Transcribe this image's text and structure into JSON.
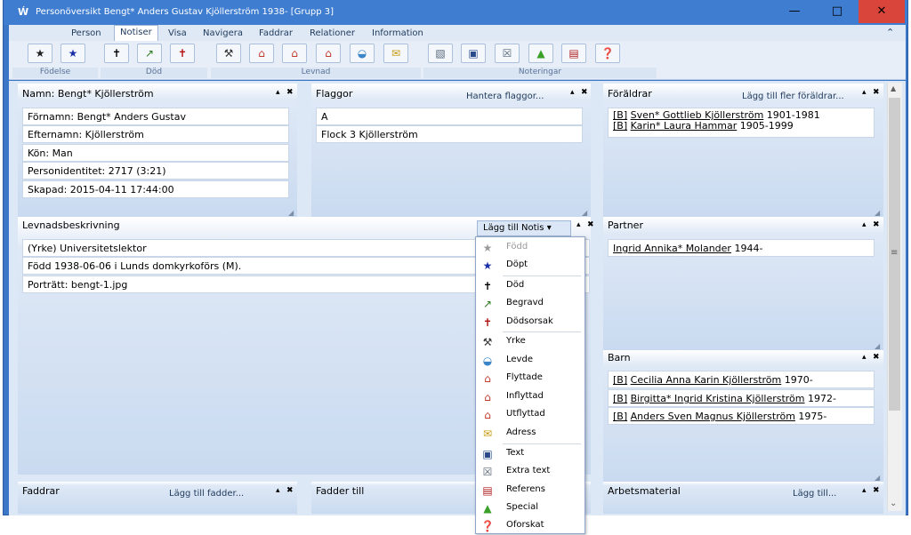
{
  "window": {
    "title": "Personöversikt Bengt* Anders Gustav Kjöllerström 1938- [Grupp 3]",
    "app_icon": "Ẃ",
    "min_glyph": "—",
    "max_glyph": "□",
    "close_glyph": "✕"
  },
  "tabs": [
    {
      "label": "Person"
    },
    {
      "label": "Notiser"
    },
    {
      "label": "Visa"
    },
    {
      "label": "Navigera"
    },
    {
      "label": "Faddrar"
    },
    {
      "label": "Relationer"
    },
    {
      "label": "Information"
    }
  ],
  "ribbon_collapse": "⌃",
  "ribbon_groups": [
    "Födelse",
    "Död",
    "Levnad",
    "Noteringar"
  ],
  "ribbon_icons": [
    {
      "icon": "gray-star-icon",
      "glyph": "★",
      "color": "#222222"
    },
    {
      "icon": "blue-star-icon",
      "glyph": "★",
      "color": "#1a2fa8"
    },
    {
      "icon": "cross-icon",
      "glyph": "✝",
      "color": "#000000"
    },
    {
      "icon": "shovel-icon",
      "glyph": "↗",
      "color": "#2a7a1a"
    },
    {
      "icon": "cross-red-icon",
      "glyph": "✝",
      "color": "#b01010"
    },
    {
      "icon": "hammer-icon",
      "glyph": "⚒",
      "color": "#333333"
    },
    {
      "icon": "house-out-icon",
      "glyph": "⌂",
      "color": "#c0392b"
    },
    {
      "icon": "house-in-icon",
      "glyph": "⌂",
      "color": "#c0392b"
    },
    {
      "icon": "house-move-icon",
      "glyph": "⌂",
      "color": "#c0392b"
    },
    {
      "icon": "globe-house-icon",
      "glyph": "◒",
      "color": "#3a86c8"
    },
    {
      "icon": "envelope-icon",
      "glyph": "✉",
      "color": "#c89a10"
    },
    {
      "icon": "picture-icon",
      "glyph": "▧",
      "color": "#556677"
    },
    {
      "icon": "text-icon",
      "glyph": "▣",
      "color": "#2a4a8a"
    },
    {
      "icon": "extra-text-icon",
      "glyph": "☒",
      "color": "#556677"
    },
    {
      "icon": "warning-icon",
      "glyph": "▲",
      "color": "#3aa02a"
    },
    {
      "icon": "reference-icon",
      "glyph": "▤",
      "color": "#b02020"
    },
    {
      "icon": "unresearched-icon",
      "glyph": "❓",
      "color": "#8a2aa8"
    }
  ],
  "namn_panel": {
    "title": "Namn: Bengt* Kjöllerström",
    "fields": [
      "Förnamn: Bengt* Anders Gustav",
      "Efternamn: Kjöllerström",
      "Kön: Man",
      "Personidentitet: 2717 (3:21)",
      "Skapad: 2015-04-11 17:44:00"
    ]
  },
  "flaggor_panel": {
    "title": "Flaggor",
    "action": "Hantera flaggor...",
    "fields": [
      "A",
      "Flock 3 Kjöllerström"
    ]
  },
  "foraldrar_panel": {
    "title": "Föräldrar",
    "action": "Lägg till fler föräldrar...",
    "items": [
      {
        "tag": "[B]",
        "name": "Sven* Gottlieb Kjöllerström",
        "years": " 1901-1981"
      },
      {
        "tag": "[B]",
        "name": "Karin* Laura Hammar",
        "years": " 1905-1999"
      }
    ]
  },
  "levnad_panel": {
    "title": "Levnadsbeskrivning",
    "dropdown": "Lägg till Notis",
    "dropdown_arrow": "▾",
    "fields": [
      "(Yrke) Universitetslektor",
      "Född 1938-06-06 i Lunds domkyrkoförs (M).",
      "Porträtt: bengt-1.jpg"
    ]
  },
  "partner_panel": {
    "title": "Partner",
    "items": [
      {
        "name": "Ingrid Annika* Molander",
        "years": " 1944-"
      }
    ]
  },
  "barn_panel": {
    "title": "Barn",
    "items": [
      {
        "tag": "[B]",
        "name": "Cecilia Anna Karin Kjöllerström",
        "years": " 1970-"
      },
      {
        "tag": "[B]",
        "name": "Birgitta* Ingrid Kristina Kjöllerström",
        "years": " 1972-"
      },
      {
        "tag": "[B]",
        "name": "Anders Sven Magnus Kjöllerström",
        "years": " 1975-"
      }
    ]
  },
  "faddrar_panel": {
    "title": "Faddrar",
    "action": "Lägg till fadder..."
  },
  "fadder_till_panel": {
    "title": "Fadder till"
  },
  "arbetsmaterial_panel": {
    "title": "Arbetsmaterial",
    "action": "Lägg till..."
  },
  "panel_controls": {
    "pin": "▴",
    "close": "✖",
    "grip": "◢"
  },
  "scrollbar": {
    "up": "▲",
    "grip": "≡",
    "down": "⌄"
  },
  "menu": {
    "items": [
      {
        "label": "Född",
        "icon": "gray-star-icon",
        "glyph": "★",
        "color": "#9a9a9a",
        "disabled": true
      },
      {
        "label": "Döpt",
        "icon": "blue-star-icon",
        "glyph": "★",
        "color": "#1a2fa8"
      },
      {
        "label": "Död",
        "icon": "cross-icon",
        "glyph": "✝",
        "color": "#000000"
      },
      {
        "label": "Begravd",
        "icon": "shovel-icon",
        "glyph": "↗",
        "color": "#2a7a1a"
      },
      {
        "label": "Dödsorsak",
        "icon": "cross-red-icon",
        "glyph": "✝",
        "color": "#b01010"
      },
      {
        "label": "Yrke",
        "icon": "hammer-icon",
        "glyph": "⚒",
        "color": "#333333"
      },
      {
        "label": "Levde",
        "icon": "globe-house-icon",
        "glyph": "◒",
        "color": "#3a86c8"
      },
      {
        "label": "Flyttade",
        "icon": "house-move-icon",
        "glyph": "⌂",
        "color": "#c0392b"
      },
      {
        "label": "Inflyttad",
        "icon": "house-in-icon",
        "glyph": "⌂",
        "color": "#c0392b"
      },
      {
        "label": "Utflyttad",
        "icon": "house-out-icon",
        "glyph": "⌂",
        "color": "#c0392b"
      },
      {
        "label": "Adress",
        "icon": "envelope-icon",
        "glyph": "✉",
        "color": "#c89a10"
      },
      {
        "label": "Text",
        "icon": "text-icon",
        "glyph": "▣",
        "color": "#2a4a8a"
      },
      {
        "label": "Extra text",
        "icon": "extra-text-icon",
        "glyph": "☒",
        "color": "#556677"
      },
      {
        "label": "Referens",
        "icon": "reference-icon",
        "glyph": "▤",
        "color": "#b02020"
      },
      {
        "label": "Special",
        "icon": "warning-icon",
        "glyph": "▲",
        "color": "#3aa02a"
      },
      {
        "label": "Oforskat",
        "icon": "unresearched-icon",
        "glyph": "❓",
        "color": "#8a2aa8"
      }
    ]
  }
}
